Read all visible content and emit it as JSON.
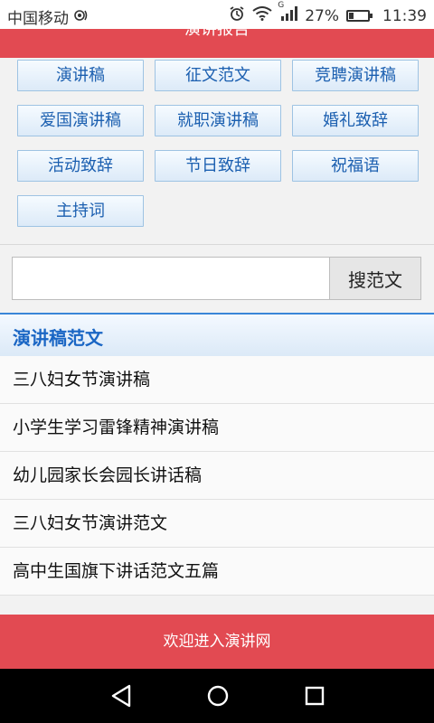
{
  "status_bar": {
    "carrier": "中国移动",
    "battery_text": "27%",
    "battery_level": 0.27,
    "time": "11:39",
    "network": "G"
  },
  "header": {
    "title": "演讲报告"
  },
  "categories": [
    "演讲稿",
    "征文范文",
    "竞聘演讲稿",
    "爱国演讲稿",
    "就职演讲稿",
    "婚礼致辞",
    "活动致辞",
    "节日致辞",
    "祝福语",
    "主持词"
  ],
  "search": {
    "value": "",
    "placeholder": "",
    "button_label": "搜范文"
  },
  "section": {
    "title": "演讲稿范文",
    "items": [
      "三八妇女节演讲稿",
      "小学生学习雷锋精神演讲稿",
      "幼儿园家长会园长讲话稿",
      "三八妇女节演讲范文",
      "高中生国旗下讲话范文五篇"
    ]
  },
  "footer": {
    "text": "欢迎进入演讲网"
  },
  "colors": {
    "accent": "#e24a52",
    "link": "#1b5fb0",
    "section_title": "#1a66c4"
  }
}
